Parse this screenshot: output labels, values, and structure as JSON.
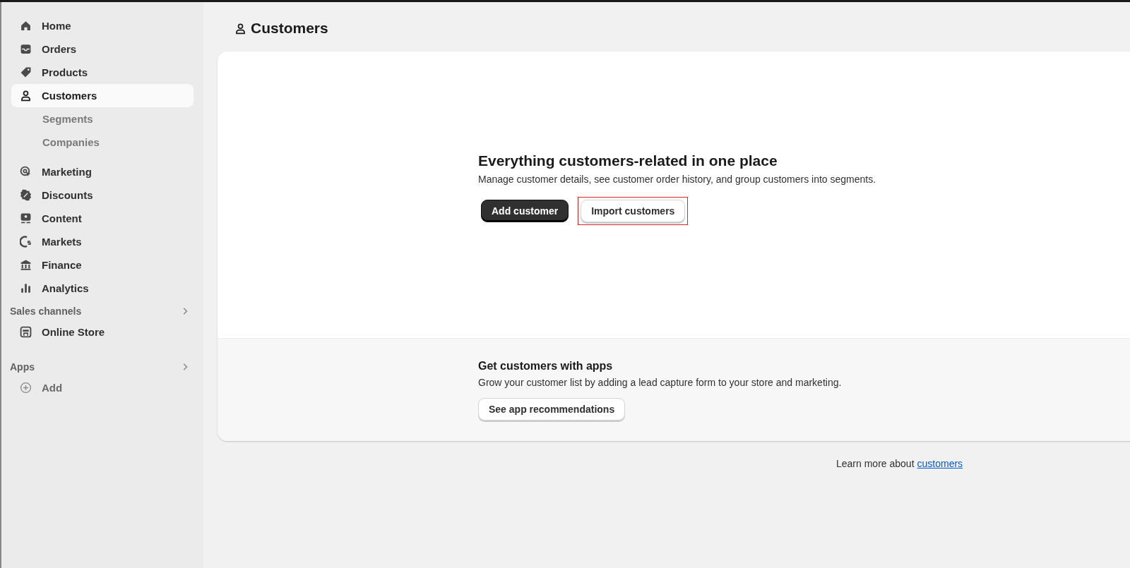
{
  "sidebar": {
    "items": [
      {
        "label": "Home",
        "selected": false
      },
      {
        "label": "Orders",
        "selected": false
      },
      {
        "label": "Products",
        "selected": false
      },
      {
        "label": "Customers",
        "selected": true,
        "children": [
          {
            "label": "Segments",
            "selected": false
          },
          {
            "label": "Companies",
            "selected": false
          }
        ]
      },
      {
        "label": "Marketing",
        "selected": false
      },
      {
        "label": "Discounts",
        "selected": false
      },
      {
        "label": "Content",
        "selected": false
      },
      {
        "label": "Markets",
        "selected": false
      },
      {
        "label": "Finance",
        "selected": false
      },
      {
        "label": "Analytics",
        "selected": false
      }
    ],
    "sections": [
      {
        "title": "Sales channels",
        "items": [
          {
            "label": "Online Store",
            "selected": false
          }
        ]
      },
      {
        "title": "Apps",
        "items": [
          {
            "label": "Add",
            "selected": false
          }
        ]
      }
    ]
  },
  "page": {
    "title": "Customers"
  },
  "hero": {
    "heading": "Everything customers-related in one place",
    "text": "Manage customer details, see customer order history, and group customers into segments.",
    "buttons": [
      {
        "label": "Add customer",
        "kind": "primary",
        "highlighted": false
      },
      {
        "label": "Import customers",
        "kind": "secondary",
        "highlighted": true
      }
    ]
  },
  "apps": {
    "heading": "Get customers with apps",
    "text": "Grow your customer list by adding a lead capture form to your store and marketing.",
    "button": "See app recommendations"
  },
  "footer": {
    "text": "Learn more about",
    "link": "customers"
  }
}
